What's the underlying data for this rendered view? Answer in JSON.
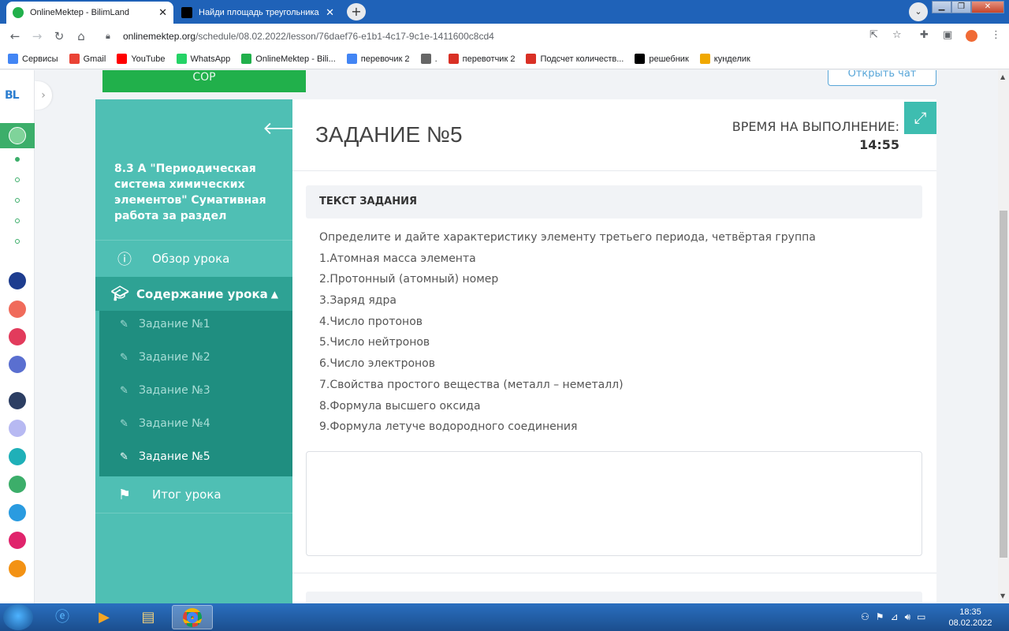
{
  "browser": {
    "tabs": [
      {
        "title": "OnlineMektep - BilimLand",
        "close": "✕"
      },
      {
        "title": "Найди площадь треугольника с",
        "close": "✕"
      }
    ],
    "new_tab": "+",
    "url_host": "onlinemektep.org",
    "url_path": "/schedule/08.02.2022/lesson/76daef76-e1b1-4c17-9c1e-1411600c8cd4",
    "bookmarks": [
      {
        "label": "Сервисы",
        "icon": "apps-grid-icon",
        "color": "#4285f4"
      },
      {
        "label": "Gmail",
        "icon": "google-g-icon",
        "color": "#ea4335"
      },
      {
        "label": "YouTube",
        "icon": "youtube-icon",
        "color": "#ff0000"
      },
      {
        "label": "WhatsApp",
        "icon": "whatsapp-icon",
        "color": "#25d366"
      },
      {
        "label": "OnlineMektep - Bili...",
        "icon": "onlinemektep-icon",
        "color": "#21b04b"
      },
      {
        "label": "перевочик 2",
        "icon": "google-g-icon",
        "color": "#4285f4"
      },
      {
        "label": ".",
        "icon": "loading-icon",
        "color": "#666666"
      },
      {
        "label": "перевотчик 2",
        "icon": "translator-icon",
        "color": "#d93025"
      },
      {
        "label": "Подсчет количеств...",
        "icon": "copyright-icon",
        "color": "#d93025"
      },
      {
        "label": "решебник",
        "icon": "znanija-icon",
        "color": "#000000"
      },
      {
        "label": "кунделик",
        "icon": "kundelik-icon",
        "color": "#f0a800"
      }
    ]
  },
  "page": {
    "cor_button": "СОР",
    "chat_button": "Открыть чат",
    "lesson_title": "8.3 А \"Периодическая система химических элементов\" Сумативная работа за раздел",
    "overview": "Обзор урока",
    "content_section": "Содержание урока",
    "tasks": [
      "Задание №1",
      "Задание №2",
      "Задание №3",
      "Задание №4",
      "Задание №5"
    ],
    "summary": "Итог урока",
    "task_heading": "ЗАДАНИЕ №5",
    "timer_label": "ВРЕМЯ НА ВЫПОЛНЕНИЕ:",
    "timer_value": "14:55",
    "task_text_header": "ТЕКСТ ЗАДАНИЯ",
    "task_lines": [
      "Определите и дайте характеристику элементу третьего периода, четвёртая группа",
      "1.Атомная масса элемента",
      "2.Протонный (атомный) номер",
      "3.Заряд ядра",
      "4.Число протонов",
      "5.Число нейтронов",
      "6.Число электронов",
      "7.Свойства простого вещества (металл – неметалл)",
      "8.Формула высшего оксида",
      "9.Формула летуче водородного соединения"
    ],
    "answer_value": ""
  },
  "rail": {
    "logo": "BL"
  },
  "taskbar": {
    "time": "18:35",
    "date": "08.02.2022"
  },
  "colors": {
    "accent": "#4fbfb4",
    "accent_dark": "#1f8e80",
    "green": "#21b04b",
    "tab_bar": "#1f62b8"
  }
}
